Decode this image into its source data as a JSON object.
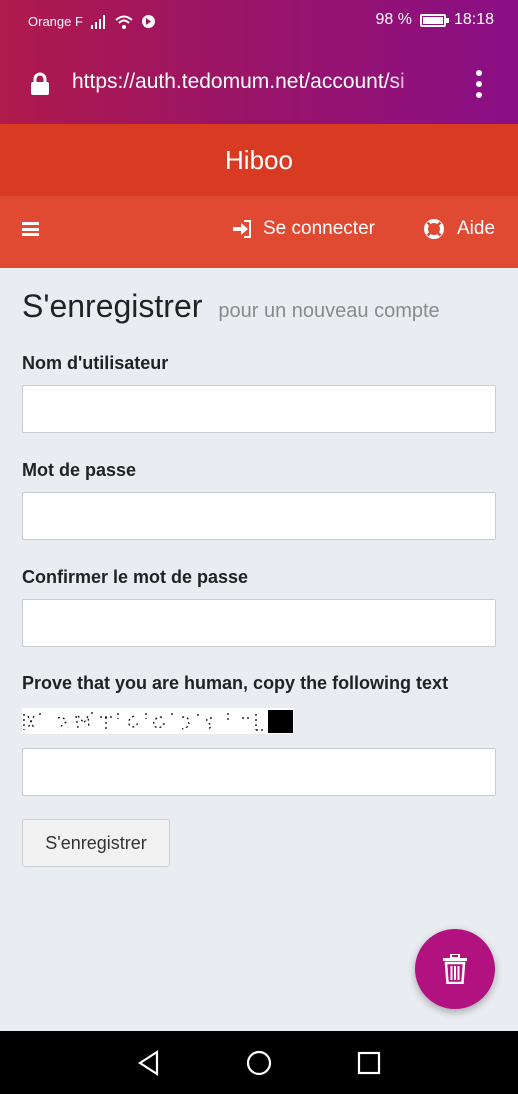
{
  "status_bar": {
    "carrier": "Orange F",
    "battery_percent_text": "98 %",
    "battery_level": 0.98,
    "time": "18:18"
  },
  "browser": {
    "url": "https://auth.tedomum.net/account/si",
    "menu_icon": "kebab-menu-icon"
  },
  "app": {
    "title": "Hiboo"
  },
  "nav": {
    "menu_icon": "hamburger-icon",
    "login_label": "Se connecter",
    "help_label": "Aide"
  },
  "page": {
    "title": "S'enregistrer",
    "subtitle": "pour un nouveau compte"
  },
  "form": {
    "username_label": "Nom d'utilisateur",
    "password_label": "Mot de passe",
    "confirm_label": "Confirmer le mot de passe",
    "captcha_label": "Prove that you are human, copy the following text",
    "submit_label": "S'enregistrer"
  },
  "fab": {
    "icon": "trash-icon"
  },
  "colors": {
    "status_gradient": [
      "#b01a4c",
      "#8a0f86"
    ],
    "title_bar": "#d83a22",
    "nav_bar": "#e04a33",
    "page_background": "#e9ecf1",
    "fab": "#b2127f"
  }
}
